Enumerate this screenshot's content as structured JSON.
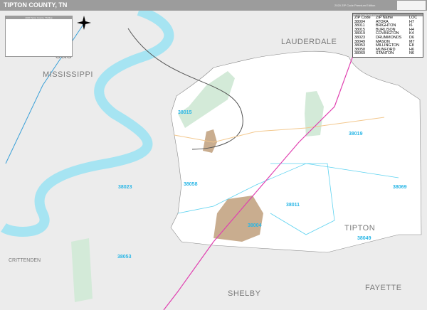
{
  "header": {
    "title": "TIPTON COUNTY, TN",
    "subtitle": "2020 ZIP Code Premium Edition"
  },
  "legend": {
    "title": "2020 Tipton County, TN Map"
  },
  "zip_table": {
    "title": "ZIP Code Index/Grid Locator",
    "headers": [
      "ZIP Code",
      "ZIP Name",
      "LOC"
    ],
    "rows": [
      [
        "38004",
        "ATOKA",
        "H7"
      ],
      [
        "38011",
        "BRIGHTON",
        "I6"
      ],
      [
        "38015",
        "BURLISON",
        "H4"
      ],
      [
        "38019",
        "COVINGTON",
        "K4"
      ],
      [
        "38023",
        "DRUMMONDS",
        "D6"
      ],
      [
        "38049",
        "MASON",
        "M7"
      ],
      [
        "38053",
        "MILLINGTON",
        "E8"
      ],
      [
        "38058",
        "MUNFORD",
        "H6"
      ],
      [
        "38069",
        "STANTON",
        "N6"
      ]
    ]
  },
  "regions": {
    "mississippi": "MISSISSIPPI",
    "lauderdale": "LAUDERDALE",
    "tipton": "TIPTON",
    "shelby": "SHELBY",
    "fayette": "FAYETTE",
    "crittenden": "CRITTENDEN",
    "arkansas": "sas"
  },
  "zips": {
    "z38015": "38015",
    "z38019": "38019",
    "z38023": "38023",
    "z38058": "38058",
    "z38011": "38011",
    "z38004": "38004",
    "z38069": "38069",
    "z38049": "38049",
    "z38053": "38053"
  },
  "colors": {
    "water": "#a6e4f2",
    "zip_line": "#5cd2f0",
    "interstate": "#e040b0",
    "county_fill": "#ffffff",
    "outside": "#ececec",
    "park": "#d3ead8",
    "city": "#c9ad8f"
  }
}
